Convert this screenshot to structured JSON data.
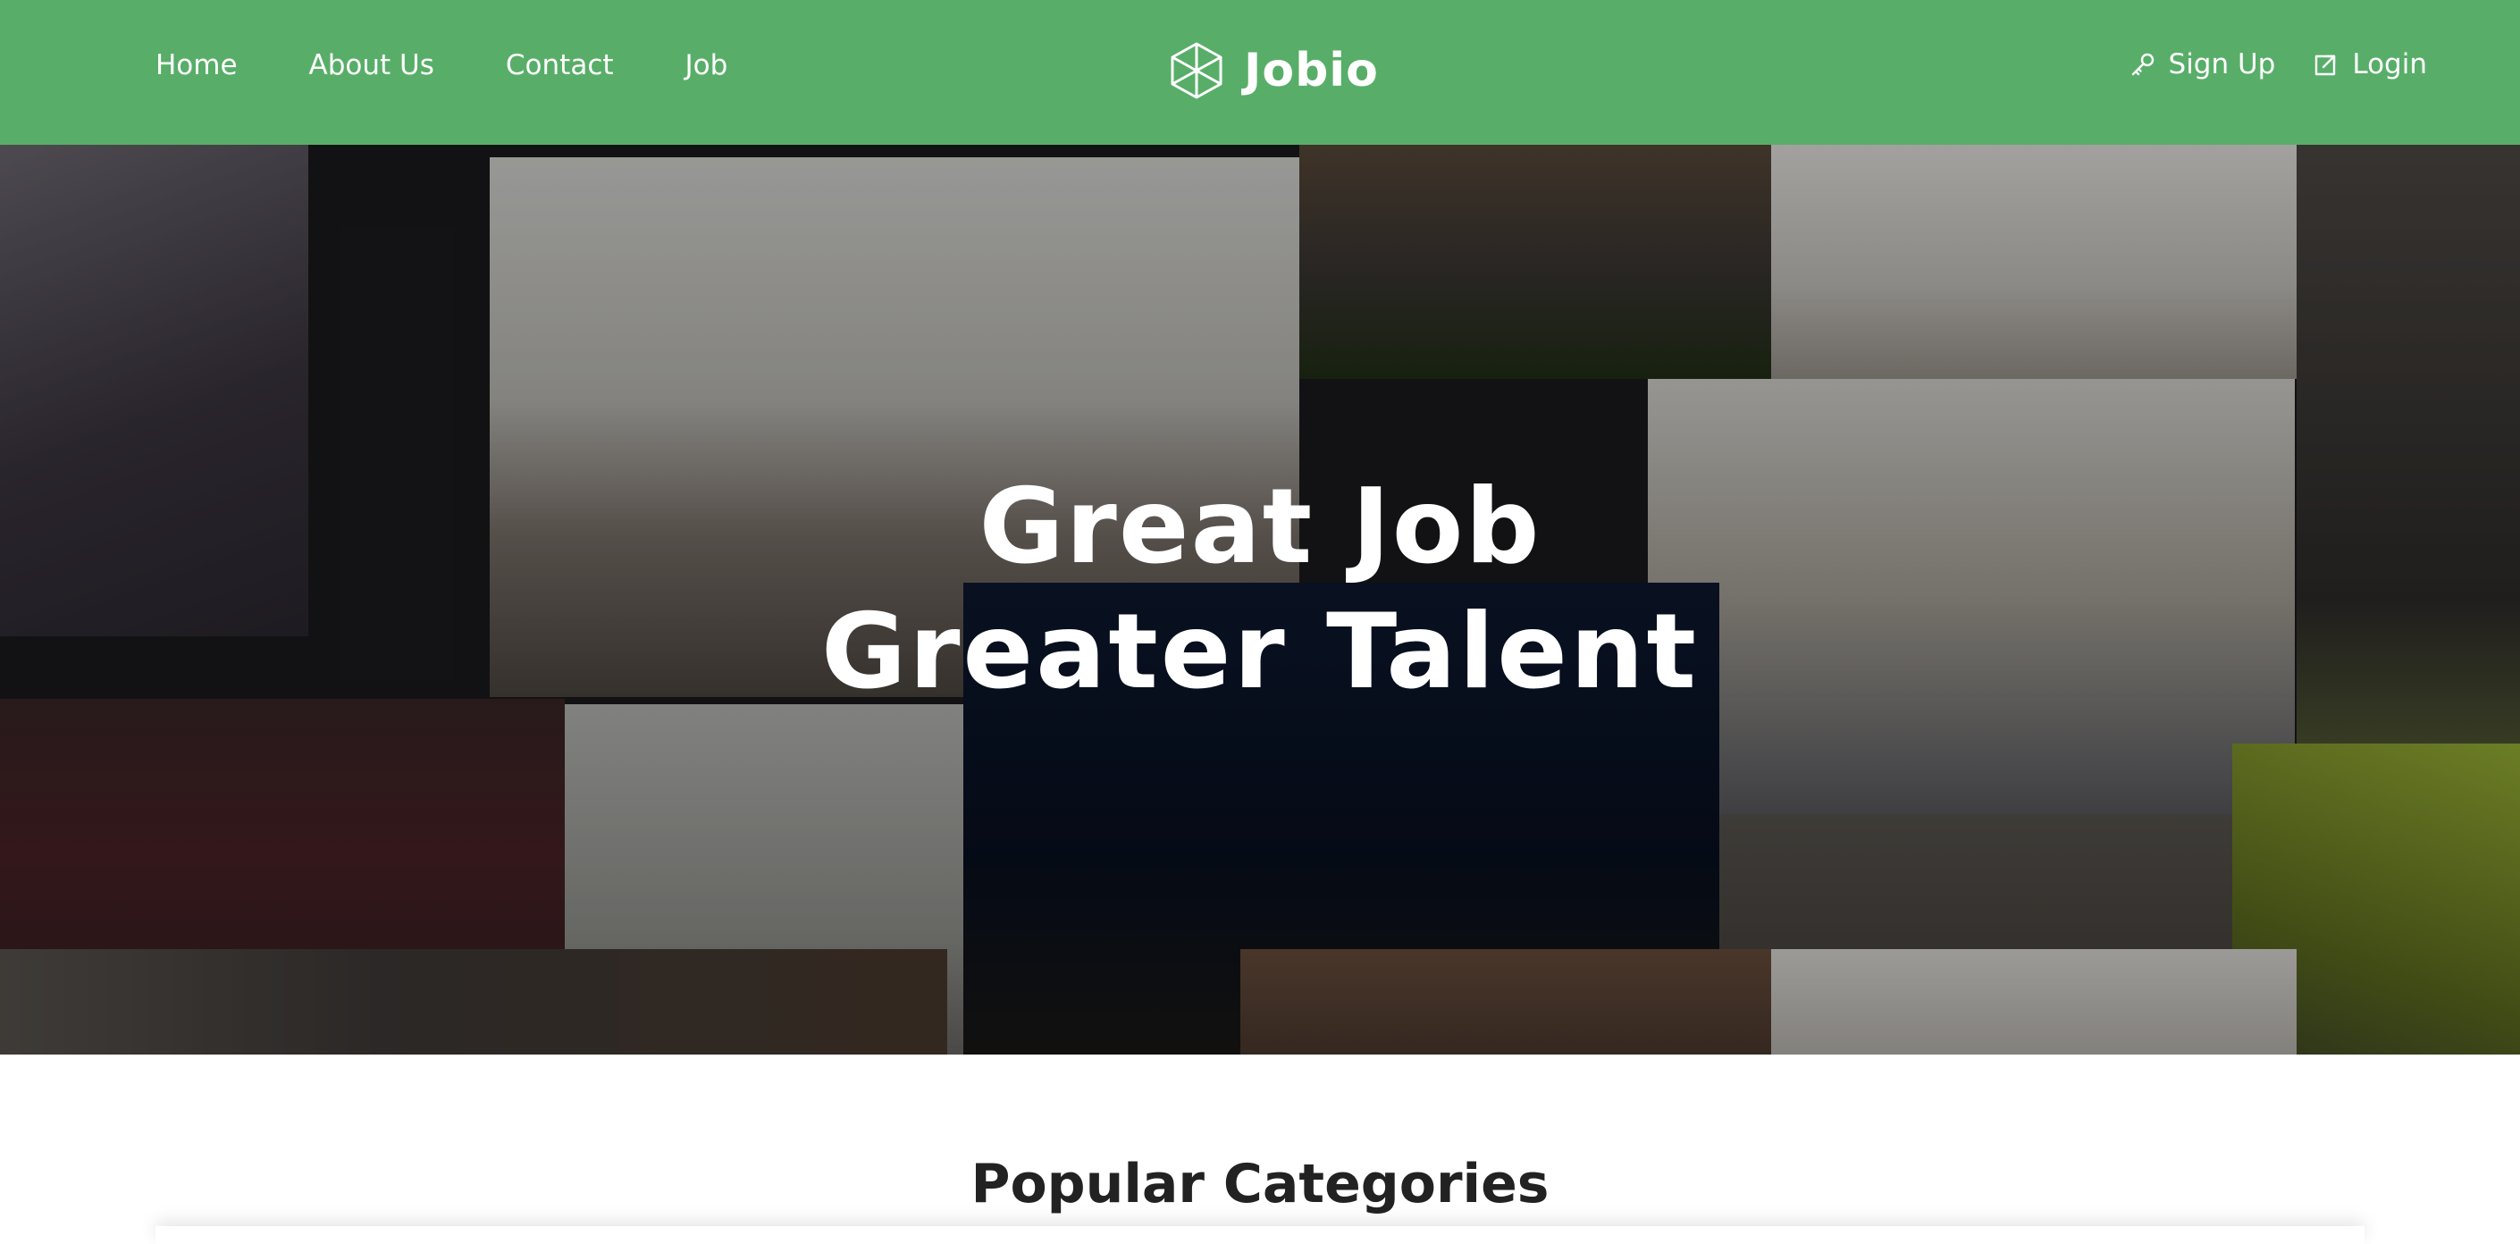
{
  "nav": {
    "links": [
      {
        "label": "Home"
      },
      {
        "label": "About Us"
      },
      {
        "label": "Contact"
      },
      {
        "label": "Job"
      }
    ],
    "brand": "Jobio",
    "signup_label": "Sign Up",
    "login_label": "Login"
  },
  "hero": {
    "title": "Great Job",
    "subtitle": "Greater Talent"
  },
  "categories": {
    "heading": "Popular Categories"
  },
  "colors": {
    "brand_green": "#58ae68",
    "hero_text": "#ffffff",
    "heading_text": "#222222"
  },
  "icons": {
    "brand": "cube-logo-icon",
    "signup": "key-icon",
    "login": "external-link-icon"
  }
}
